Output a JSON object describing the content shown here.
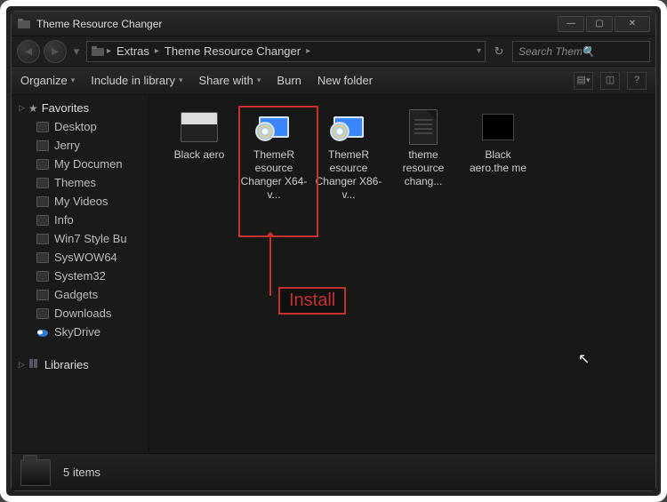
{
  "window": {
    "title": "Theme Resource Changer",
    "minimize": "—",
    "maximize": "▢",
    "close": "✕"
  },
  "breadcrumbs": [
    "Extras",
    "Theme Resource Changer"
  ],
  "search": {
    "placeholder": "Search Theme Re..."
  },
  "toolbar": {
    "organize": "Organize",
    "include": "Include in library",
    "share": "Share with",
    "burn": "Burn",
    "newfolder": "New folder"
  },
  "sidebar": {
    "favorites_label": "Favorites",
    "favorites": [
      "Desktop",
      "Jerry",
      "My Documen",
      "Themes",
      "My Videos",
      "Info",
      "Win7 Style Bu",
      "SysWOW64",
      "System32",
      "Gadgets",
      "Downloads"
    ],
    "skydrive": "SkyDrive",
    "libraries_label": "Libraries"
  },
  "files": [
    {
      "type": "folder",
      "name": "Black aero"
    },
    {
      "type": "exe",
      "name": "ThemeR esource Changer X64-v..."
    },
    {
      "type": "exe",
      "name": "ThemeR esource Changer X86-v..."
    },
    {
      "type": "doc",
      "name": "theme resource chang..."
    },
    {
      "type": "theme",
      "name": "Black aero.the me"
    }
  ],
  "status": {
    "count": "5 items"
  },
  "annotation": {
    "label": "Install",
    "highlighted_file_index": 1
  }
}
